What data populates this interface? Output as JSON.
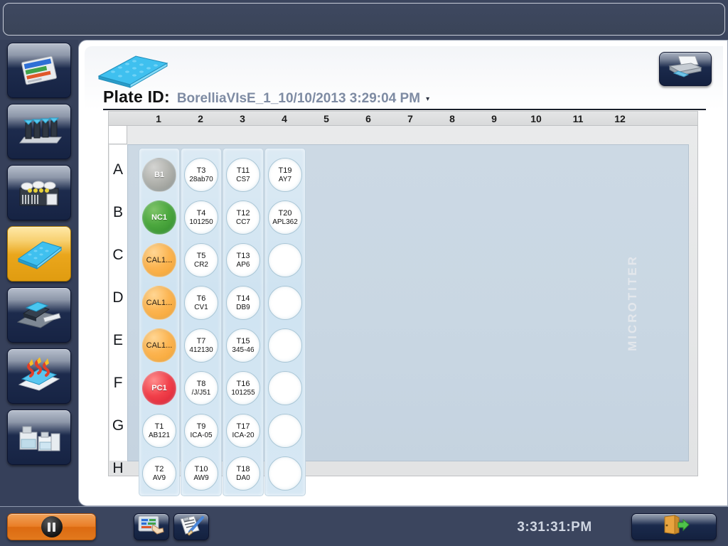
{
  "app": {
    "titlebar_text": "",
    "clock": "3:31:31:PM"
  },
  "sidebar": {
    "items": [
      {
        "id": "worklist",
        "icon": "worklist-tray-icon",
        "active": false
      },
      {
        "id": "tips",
        "icon": "tip-rack-icon",
        "active": false
      },
      {
        "id": "samples",
        "icon": "sample-rack-icon",
        "active": false
      },
      {
        "id": "plates",
        "icon": "microplate-icon",
        "active": true
      },
      {
        "id": "washer",
        "icon": "plate-washer-icon",
        "active": false
      },
      {
        "id": "incubator",
        "icon": "plate-heater-icon",
        "active": false
      },
      {
        "id": "reagents",
        "icon": "reagent-bottles-icon",
        "active": false
      }
    ]
  },
  "panel": {
    "plate_thumb_icon": "microplate-icon",
    "print_button_icon": "printer-icon",
    "plate_id_label": "Plate ID:",
    "plate_id_value": "BorelliaVIsE_1_10/10/2013 3:29:04 PM",
    "plate_id_caret": "▾",
    "plate_watermark": "MICROTITER"
  },
  "plate": {
    "columns": [
      "1",
      "2",
      "3",
      "4",
      "5",
      "6",
      "7",
      "8",
      "9",
      "10",
      "11",
      "12"
    ],
    "rows": [
      "A",
      "B",
      "C",
      "D",
      "E",
      "F",
      "G",
      "H"
    ],
    "used_columns": [
      1,
      2,
      3,
      4
    ],
    "wells": [
      {
        "pos": "A1",
        "line1": "B1",
        "line2": "",
        "kind": "gray"
      },
      {
        "pos": "B1",
        "line1": "NC1",
        "line2": "",
        "kind": "green"
      },
      {
        "pos": "C1",
        "line1": "CAL1...",
        "line2": "",
        "kind": "orange"
      },
      {
        "pos": "D1",
        "line1": "CAL1...",
        "line2": "",
        "kind": "orange"
      },
      {
        "pos": "E1",
        "line1": "CAL1...",
        "line2": "",
        "kind": "orange"
      },
      {
        "pos": "F1",
        "line1": "PC1",
        "line2": "",
        "kind": "red"
      },
      {
        "pos": "G1",
        "line1": "T1",
        "line2": "AB121",
        "kind": "sample"
      },
      {
        "pos": "H1",
        "line1": "T2",
        "line2": "AV9",
        "kind": "sample"
      },
      {
        "pos": "A2",
        "line1": "T3",
        "line2": "28ab70",
        "kind": "sample"
      },
      {
        "pos": "B2",
        "line1": "T4",
        "line2": "101250",
        "kind": "sample"
      },
      {
        "pos": "C2",
        "line1": "T5",
        "line2": "CR2",
        "kind": "sample"
      },
      {
        "pos": "D2",
        "line1": "T6",
        "line2": "CV1",
        "kind": "sample"
      },
      {
        "pos": "E2",
        "line1": "T7",
        "line2": "412130",
        "kind": "sample"
      },
      {
        "pos": "F2",
        "line1": "T8",
        "line2": "/J/J51",
        "kind": "sample"
      },
      {
        "pos": "G2",
        "line1": "T9",
        "line2": "ICA-05",
        "kind": "sample"
      },
      {
        "pos": "H2",
        "line1": "T10",
        "line2": "AW9",
        "kind": "sample"
      },
      {
        "pos": "A3",
        "line1": "T11",
        "line2": "CS7",
        "kind": "sample"
      },
      {
        "pos": "B3",
        "line1": "T12",
        "line2": "CC7",
        "kind": "sample"
      },
      {
        "pos": "C3",
        "line1": "T13",
        "line2": "AP6",
        "kind": "sample"
      },
      {
        "pos": "D3",
        "line1": "T14",
        "line2": "DB9",
        "kind": "sample"
      },
      {
        "pos": "E3",
        "line1": "T15",
        "line2": "345-46",
        "kind": "sample"
      },
      {
        "pos": "F3",
        "line1": "T16",
        "line2": "101255",
        "kind": "sample"
      },
      {
        "pos": "G3",
        "line1": "T17",
        "line2": "ICA-20",
        "kind": "sample"
      },
      {
        "pos": "H3",
        "line1": "T18",
        "line2": "DA0",
        "kind": "sample"
      },
      {
        "pos": "A4",
        "line1": "T19",
        "line2": "AY7",
        "kind": "sample"
      },
      {
        "pos": "B4",
        "line1": "T20",
        "line2": "APL362",
        "kind": "sample"
      },
      {
        "pos": "C4",
        "line1": "",
        "line2": "",
        "kind": "empty"
      },
      {
        "pos": "D4",
        "line1": "",
        "line2": "",
        "kind": "empty"
      },
      {
        "pos": "E4",
        "line1": "",
        "line2": "",
        "kind": "empty"
      },
      {
        "pos": "F4",
        "line1": "",
        "line2": "",
        "kind": "empty"
      },
      {
        "pos": "G4",
        "line1": "",
        "line2": "",
        "kind": "empty"
      },
      {
        "pos": "H4",
        "line1": "",
        "line2": "",
        "kind": "empty"
      }
    ]
  },
  "bottombar": {
    "pause_icon": "pause-icon",
    "tools": [
      {
        "id": "screen",
        "icon": "touchscreen-icon"
      },
      {
        "id": "report",
        "icon": "clipboard-pen-icon"
      }
    ],
    "exit_icon": "exit-door-icon"
  },
  "colors": {
    "chrome": "#3b455e",
    "accent_orange": "#ea7f27",
    "plate_id_value": "#7e8ba3",
    "control_blank": "#b2b3ae",
    "control_negative": "#4da83f",
    "control_calibrator": "#fcb450",
    "control_positive": "#f1404a"
  }
}
